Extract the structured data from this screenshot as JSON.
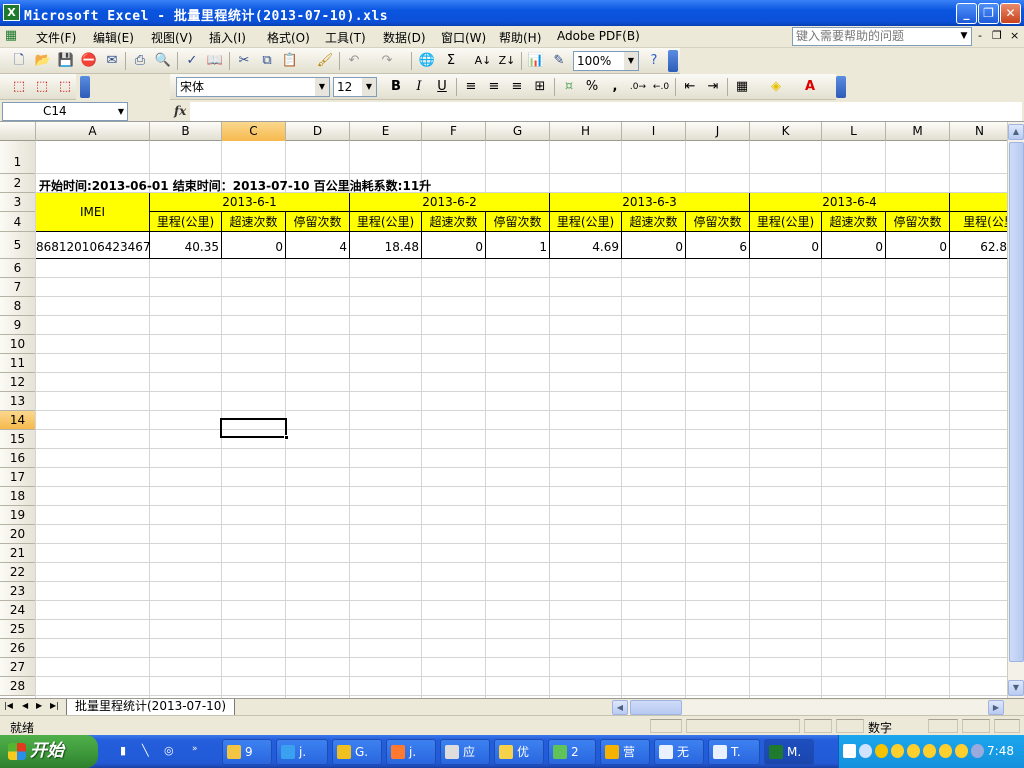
{
  "window": {
    "title": "Microsoft Excel - 批量里程统计(2013-07-10).xls",
    "minimize": "_",
    "restore": "❐",
    "close": "✕"
  },
  "menu": {
    "items": [
      "文件(F)",
      "编辑(E)",
      "视图(V)",
      "插入(I)",
      "格式(O)",
      "工具(T)",
      "数据(D)",
      "窗口(W)",
      "帮助(H)",
      "Adobe PDF(B)"
    ],
    "help_placeholder": "键入需要帮助的问题",
    "mdi_min": "-",
    "mdi_restore": "❐",
    "mdi_close": "×"
  },
  "toolbar": {
    "zoom": "100%",
    "font": "宋体",
    "font_size": "12",
    "bold": "B",
    "italic": "I",
    "underline": "U",
    "percent": "%",
    "comma": ",",
    "sigma": "Σ"
  },
  "formula": {
    "name_box": "C14",
    "fx": "fx",
    "content": ""
  },
  "columns": [
    "A",
    "B",
    "C",
    "D",
    "E",
    "F",
    "G",
    "H",
    "I",
    "J",
    "K",
    "L",
    "M",
    "N"
  ],
  "selected_column": "C",
  "rows": [
    "1",
    "2",
    "3",
    "4",
    "5",
    "6",
    "7",
    "8",
    "9",
    "10",
    "11",
    "12",
    "13",
    "14",
    "15",
    "16",
    "17",
    "18",
    "19",
    "20",
    "21",
    "22",
    "23",
    "24",
    "25",
    "26",
    "27",
    "28"
  ],
  "selected_row": "14",
  "sheet": {
    "info_row": "开始时间:2013-06-01  结束时间：2013-07-10  百公里油耗系数:11升",
    "imei_header": "IMEI",
    "dates": [
      "2013-6-1",
      "2013-6-2",
      "2013-6-3",
      "2013-6-4"
    ],
    "sub_headers": [
      "里程(公里)",
      "超速次数",
      "停留次数"
    ],
    "partial_sub_header": "里程(公里",
    "data_row": {
      "imei": "868120106423467",
      "values": [
        "40.35",
        "0",
        "4",
        "18.48",
        "0",
        "1",
        "4.69",
        "0",
        "6",
        "0",
        "0",
        "0"
      ],
      "partial_value": "62.8"
    }
  },
  "tabs": {
    "sheet_name": "批量里程统计(2013-07-10)",
    "nav_first": "|◀",
    "nav_prev": "◀",
    "nav_next": "▶",
    "nav_last": "▶|"
  },
  "status": {
    "ready": "就绪",
    "num": "数字"
  },
  "taskbar": {
    "start": "开始",
    "tasks": [
      "9",
      "j.",
      "G.",
      "j.",
      "应",
      "优",
      "2",
      "营",
      "无",
      "T.",
      "M."
    ],
    "clock": "7:48"
  }
}
